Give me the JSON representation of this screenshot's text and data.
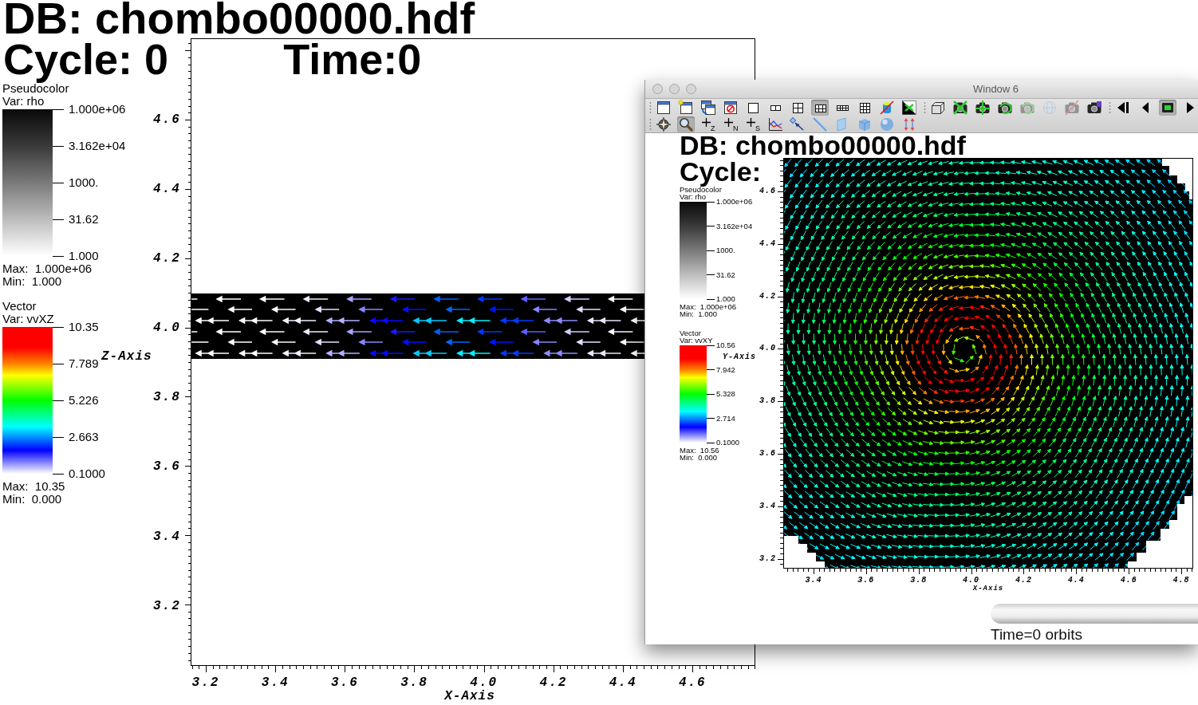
{
  "main_window": {
    "database": "DB: chombo00000.hdf",
    "cycle": "Cycle: 0",
    "time": "Time:0",
    "legends": [
      {
        "kind": "pseudocolor",
        "title": "Pseudocolor",
        "variable": "Var: rho",
        "labels": [
          "1.000e+06",
          "3.162e+04",
          "1000.",
          "31.62",
          "1.000"
        ],
        "max": "Max:  1.000e+06",
        "min": "Min:  1.000"
      },
      {
        "kind": "vector",
        "title": "Vector",
        "variable": "Var: vvXZ",
        "labels": [
          "10.35",
          "7.789",
          "5.226",
          "2.663",
          "0.1000"
        ],
        "max": "Max:  10.35",
        "min": "Min:  0.000"
      }
    ],
    "y_axis": {
      "title": "Z-Axis",
      "ticks": [
        "4.6",
        "4.4",
        "4.2",
        "4.0",
        "3.8",
        "3.6",
        "3.4",
        "3.2"
      ]
    },
    "x_axis": {
      "title": "X-Axis",
      "ticks": [
        "3.2",
        "3.4",
        "3.6",
        "3.8",
        "4.0",
        "4.2",
        "4.4",
        "4.6"
      ]
    }
  },
  "window": {
    "title": "Window 6",
    "active": false,
    "toolbar": {
      "rows": [
        {
          "groups": [
            {
              "items": [
                {
                  "kind": "window",
                  "pressed": false,
                  "disabled": false
                },
                {
                  "kind": "window_sparkle",
                  "pressed": false,
                  "disabled": false
                },
                {
                  "kind": "stacked_windows",
                  "pressed": false,
                  "disabled": false
                },
                {
                  "kind": "window_prohibit",
                  "pressed": false,
                  "disabled": false
                },
                {
                  "kind": "pane1",
                  "pressed": false,
                  "disabled": false
                },
                {
                  "kind": "pane2",
                  "pressed": false,
                  "disabled": false
                },
                {
                  "kind": "pane4",
                  "pressed": false,
                  "disabled": false
                },
                {
                  "kind": "pane6",
                  "pressed": true,
                  "disabled": false
                },
                {
                  "kind": "pane8",
                  "pressed": false,
                  "disabled": false
                },
                {
                  "kind": "pane9",
                  "pressed": false,
                  "disabled": false
                },
                {
                  "kind": "crossed_cylinder",
                  "pressed": false,
                  "disabled": false
                },
                {
                  "kind": "triangle_arrows",
                  "pressed": false,
                  "disabled": false
                }
              ]
            },
            {
              "items": [
                {
                  "kind": "wire_cube",
                  "pressed": false,
                  "disabled": false
                },
                {
                  "kind": "camera_cross",
                  "pressed": false,
                  "disabled": false
                },
                {
                  "kind": "camera_move",
                  "pressed": false,
                  "disabled": false
                },
                {
                  "kind": "camera_cycle",
                  "pressed": false,
                  "disabled": false
                },
                {
                  "kind": "camera_cycle",
                  "pressed": false,
                  "disabled": true
                },
                {
                  "kind": "globe",
                  "pressed": false,
                  "disabled": true
                },
                {
                  "kind": "crossed_camera",
                  "pressed": false,
                  "disabled": true
                },
                {
                  "kind": "camera_tag",
                  "pressed": false,
                  "disabled": false
                }
              ]
            },
            {
              "items": [
                {
                  "kind": "step_back",
                  "pressed": false,
                  "disabled": false
                },
                {
                  "kind": "reverse",
                  "pressed": false,
                  "disabled": false
                },
                {
                  "kind": "stop",
                  "pressed": true,
                  "disabled": false
                },
                {
                  "kind": "play",
                  "pressed": false,
                  "disabled": false
                }
              ]
            }
          ]
        },
        {
          "groups": [
            {
              "items": [
                {
                  "kind": "compass",
                  "pressed": false,
                  "disabled": false
                },
                {
                  "kind": "magnifier",
                  "pressed": true,
                  "disabled": false
                },
                {
                  "kind": "pick",
                  "label": "Z",
                  "pressed": false,
                  "disabled": false
                },
                {
                  "kind": "pick",
                  "label": "N",
                  "pressed": false,
                  "disabled": false
                },
                {
                  "kind": "pick",
                  "label": "S",
                  "pressed": false,
                  "disabled": false
                },
                {
                  "kind": "line_chart",
                  "pressed": false,
                  "disabled": false
                },
                {
                  "kind": "pointer",
                  "pressed": false,
                  "disabled": false
                },
                {
                  "kind": "line",
                  "pressed": false,
                  "disabled": false
                },
                {
                  "kind": "sheet",
                  "pressed": false,
                  "disabled": false
                },
                {
                  "kind": "cube",
                  "pressed": false,
                  "disabled": false
                },
                {
                  "kind": "sphere",
                  "pressed": false,
                  "disabled": false
                },
                {
                  "kind": "double_arrows",
                  "pressed": false,
                  "disabled": false
                }
              ]
            }
          ]
        }
      ]
    },
    "plot": {
      "database": "DB: chombo00000.hdf",
      "cycle": "Cycle:",
      "legends": [
        {
          "kind": "pseudocolor",
          "title": "Pseudocolor",
          "variable": "Var: rho",
          "labels": [
            "1.000e+06",
            "3.162e+04",
            "1000.",
            "31.62",
            "1.000"
          ],
          "max": "Max:  1.000e+06",
          "min": "Min:  1.000"
        },
        {
          "kind": "vector",
          "title": "Vector",
          "variable": "Var: vvXY",
          "labels": [
            "10.56",
            "7.942",
            "5.328",
            "2.714",
            "0.1000"
          ],
          "max": "Max:  10.56",
          "min": "Min:  0.000"
        }
      ],
      "y_axis": {
        "title": "Y-Axis",
        "ticks": [
          "4.6",
          "4.4",
          "4.2",
          "4.0",
          "3.8",
          "3.6",
          "3.4",
          "3.2"
        ]
      },
      "x_axis": {
        "title": "X-Axis",
        "ticks": [
          "3.4",
          "3.6",
          "3.8",
          "4.0",
          "4.2",
          "4.4",
          "4.6",
          "4.8"
        ]
      },
      "time_slider": {
        "level": 0,
        "label": "Time=0 orbits"
      }
    }
  }
}
